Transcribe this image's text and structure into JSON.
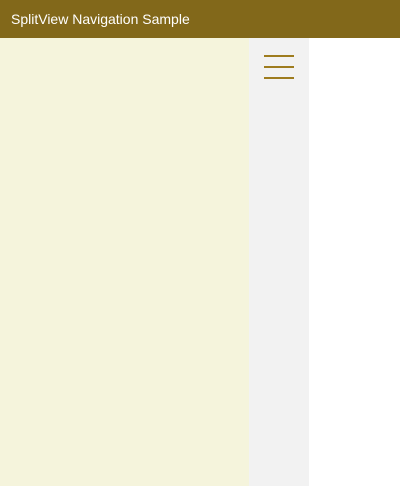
{
  "window": {
    "title": "SplitView Navigation Sample"
  },
  "nav": {
    "toggle_icon": "hamburger-menu-icon"
  },
  "colors": {
    "title_bar": "#82681a",
    "pane_background": "#f5f4dc",
    "rail_background": "#f2f2f2",
    "accent": "#9e7c1e",
    "content_background": "#ffffff"
  }
}
